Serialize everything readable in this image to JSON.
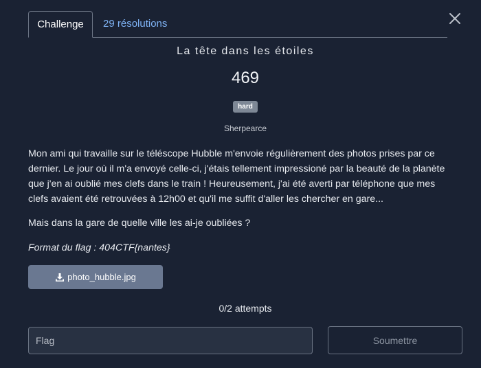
{
  "tabs": {
    "challenge_label": "Challenge",
    "solves_label": "29 résolutions"
  },
  "challenge": {
    "name": "La tête dans les étoiles",
    "value": "469",
    "difficulty": "hard",
    "author": "Sherpearce",
    "description": "Mon ami qui travaille sur le téléscope Hubble m'envoie régulièrement des photos prises par ce dernier. Le jour où il m'a envoyé celle-ci, j'étais tellement impressioné par la beauté de la planète que j'en ai oublié mes clefs dans le train ! Heureusement, j'ai été averti par téléphone que mes clefs avaient été retrouvées à 12h00 et qu'il me suffit d'aller les chercher en gare...",
    "question": "Mais dans la gare de quelle ville les ai-je oubliées ?",
    "flag_format": "Format du flag : 404CTF{nantes}"
  },
  "file": {
    "name": "photo_hubble.jpg",
    "icon": "download-icon"
  },
  "attempts": "0/2 attempts",
  "flag_input": {
    "placeholder": "Flag",
    "value": ""
  },
  "submit_label": "Soumettre",
  "icons": {
    "close": "close-icon"
  },
  "colors": {
    "background": "#1a2233",
    "link": "#7fb3f5",
    "badge": "#7e8896",
    "download_button": "#6a7891"
  }
}
